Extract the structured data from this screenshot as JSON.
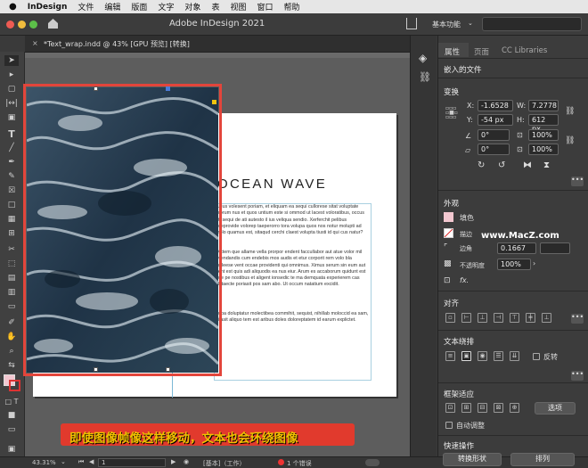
{
  "menubar": {
    "app": "InDesign",
    "items": [
      "文件",
      "编辑",
      "版面",
      "文字",
      "对象",
      "表",
      "视图",
      "窗口",
      "帮助"
    ]
  },
  "appbar": {
    "title": "Adobe InDesign 2021",
    "workspace": "基本功能"
  },
  "doc_tab": {
    "label": "*Text_wrap.indd @ 43% [GPU 预览] [转换]"
  },
  "layout": {
    "title": "OCEAN WAVE",
    "paragraphs": [
      "Axius volesent poriam, et eliquam ea sequi cullorese sitat voluptate prorum nus et quos untium este si ommod ut lacest voloratibus, occus et, sequi de ati autesto il ius veliqua sendio. Xerferchit pelibus aceprovide volorep taeperorro tora volupa quos nos notur molupti ad molo quamus est, sitaqud cerchi claest volupta tiusti id qui cus natur?",
      "Dictem que allame vella prorpor endent faccullabor aut atue volor mil evendandis cum endebis mos audis et etur corporit rem volo bla culleese vent occae providenti qui omnimus. Ximus serum sin eum aut vent est quis adi aliquodis ea nus eiur. Arum es accaborum quidunt est que pe nostibus et aligent ionsedic te ma demquata experierem cas aliitaecte poriasit pos sam abo. Ut occum natatium excidit.",
      "Lupa doluptatur molectibea commihit, sequist, nihillab moloccid ea sam, sitasit aliquo tem est aribus doles doloreptatem id earum explictet."
    ]
  },
  "caption": "即使图像帧像这样移动，文本也会环绕图像",
  "watermark": "www.MacZ.com",
  "panel": {
    "tabs": [
      "属性",
      "页面",
      "CC Libraries"
    ],
    "embedded": "嵌入的文件",
    "transform": {
      "title": "变换",
      "x_label": "X:",
      "x": "-1.6528",
      "y_label": "Y:",
      "y": "-54 px",
      "w_label": "W:",
      "w": "7.2778",
      "h_label": "H:",
      "h": "612 px",
      "angle": "0°",
      "shear": "0°",
      "scale_x": "100%",
      "scale_y": "100%"
    },
    "appearance": {
      "title": "外观",
      "fill": "填色",
      "stroke": "描边",
      "corner": "边角",
      "stroke_weight": "0.1667",
      "opacity_label": "不透明度",
      "opacity": "100%",
      "fx": "fx."
    },
    "align": {
      "title": "对齐"
    },
    "wrap": {
      "title": "文本绕排",
      "invert": "反转"
    },
    "fit": {
      "title": "框架适应",
      "options": "选项",
      "auto": "自动调整"
    },
    "quick": {
      "title": "快速操作",
      "convert": "转换形状",
      "arrange": "排列"
    }
  },
  "status": {
    "zoom": "43.31%",
    "page": "1",
    "master": "[基本]（工作）",
    "errors": "1 个错误"
  }
}
